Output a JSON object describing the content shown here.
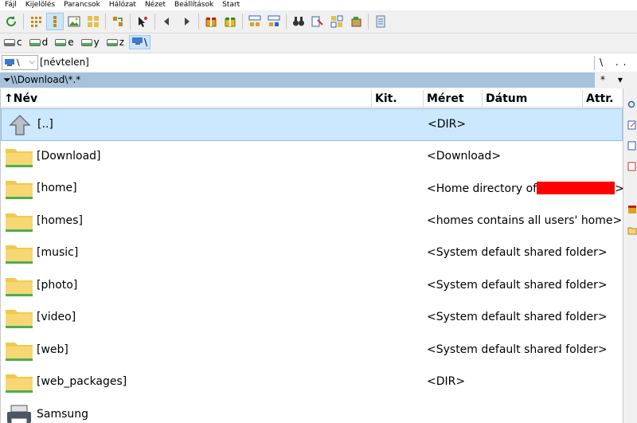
{
  "menu": [
    "Fájl",
    "Kijelölés",
    "Parancsok",
    "Hálózat",
    "Nézet",
    "Beállítások",
    "Start"
  ],
  "drives": [
    {
      "letter": "c",
      "selected": false
    },
    {
      "letter": "d",
      "selected": false
    },
    {
      "letter": "e",
      "selected": false
    },
    {
      "letter": "y",
      "selected": false
    },
    {
      "letter": "z",
      "selected": false
    },
    {
      "letter": "\\",
      "selected": true
    }
  ],
  "current_drive": {
    "value": "\\",
    "label": "[névtelen]",
    "right_buttons": "\\ .."
  },
  "path": {
    "text": "\\\\Download\\*.*",
    "filter": "*"
  },
  "columns": {
    "name": "Név",
    "ext": "Kit.",
    "size": "Méret",
    "date": "Dátum",
    "attr": "Attr."
  },
  "files": [
    {
      "name": "[..]",
      "size": "<DIR>",
      "icon": "up-icon"
    },
    {
      "name": "[Download]",
      "size": "<Download>",
      "icon": "folder-icon"
    },
    {
      "name": "[home]",
      "size": "<Home directory of",
      "size_suffix": ">",
      "icon": "folder-icon"
    },
    {
      "name": "[homes]",
      "size": "<homes contains all users' home>",
      "icon": "folder-icon"
    },
    {
      "name": "[music]",
      "size": "<System default shared folder>",
      "icon": "folder-icon"
    },
    {
      "name": "[photo]",
      "size": "<System default shared folder>",
      "icon": "folder-icon"
    },
    {
      "name": "[video]",
      "size": "<System default shared folder>",
      "icon": "folder-icon"
    },
    {
      "name": "[web]",
      "size": "<System default shared folder>",
      "icon": "folder-icon"
    },
    {
      "name": "[web_packages]",
      "size": "<DIR>",
      "icon": "folder-icon"
    },
    {
      "name": "Samsung",
      "size": "",
      "icon": "printer-icon"
    }
  ],
  "colors": {
    "selection": "#cce8ff",
    "path_bar": "#a8c2dc",
    "folder": "#f7d774",
    "redaction": "#ff0000"
  }
}
